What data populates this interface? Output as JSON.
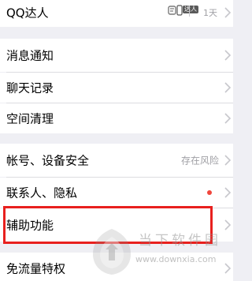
{
  "header_row": {
    "label": "QQ达人",
    "badge_text": "达人",
    "days": "1天"
  },
  "sections": [
    {
      "items": [
        {
          "label": "消息通知"
        },
        {
          "label": "聊天记录"
        },
        {
          "label": "空间清理"
        }
      ]
    },
    {
      "items": [
        {
          "label": "帐号、设备安全",
          "value": "存在风险"
        },
        {
          "label": "联系人、隐私",
          "has_dot": true
        },
        {
          "label": "辅助功能",
          "highlighted": true
        }
      ]
    },
    {
      "items": [
        {
          "label": "免流量特权"
        }
      ]
    }
  ],
  "watermark": {
    "title": "当下软件园",
    "url": "www.downxia.com"
  },
  "colors": {
    "background": "#efeff4",
    "highlight_border": "#e8201e",
    "dot": "#f0463c",
    "secondary_text": "#a0a0a5"
  }
}
